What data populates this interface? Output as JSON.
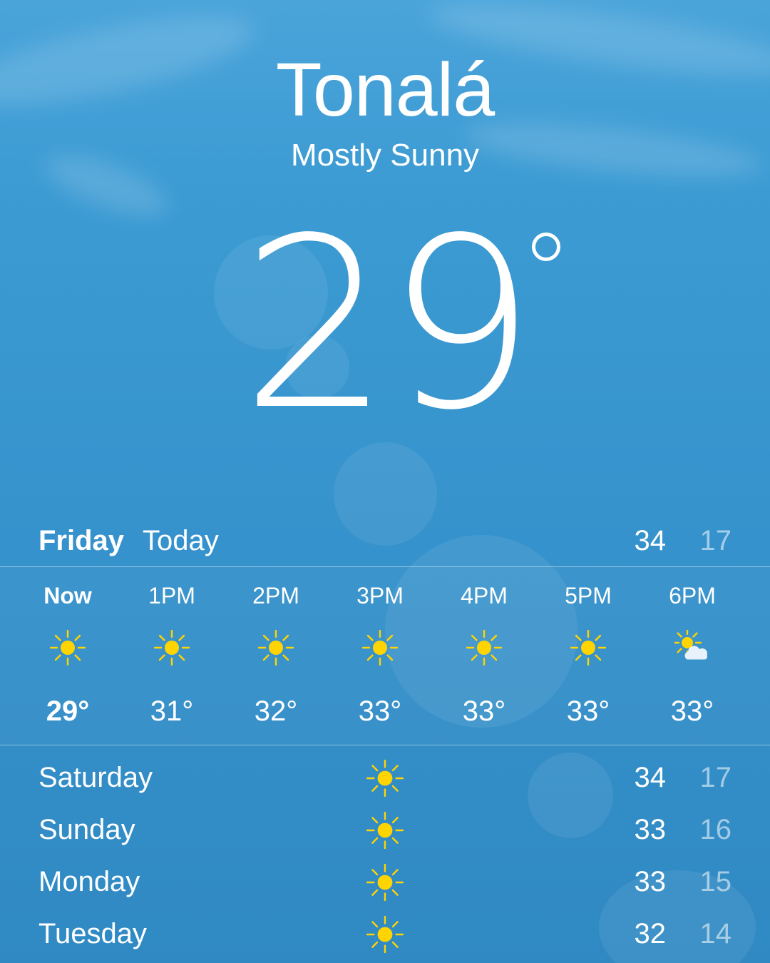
{
  "location": "Tonalá",
  "condition": "Mostly Sunny",
  "current_temp": "29",
  "today": {
    "day": "Friday",
    "label": "Today",
    "high": "34",
    "low": "17"
  },
  "hourly": [
    {
      "time": "Now",
      "icon": "sun-icon",
      "temp": "29°"
    },
    {
      "time": "1PM",
      "icon": "sun-icon",
      "temp": "31°"
    },
    {
      "time": "2PM",
      "icon": "sun-icon",
      "temp": "32°"
    },
    {
      "time": "3PM",
      "icon": "sun-icon",
      "temp": "33°"
    },
    {
      "time": "4PM",
      "icon": "sun-icon",
      "temp": "33°"
    },
    {
      "time": "5PM",
      "icon": "sun-icon",
      "temp": "33°"
    },
    {
      "time": "6PM",
      "icon": "partly-cloudy-icon",
      "temp": "33°"
    }
  ],
  "daily": [
    {
      "day": "Saturday",
      "icon": "sun-icon",
      "high": "34",
      "low": "17"
    },
    {
      "day": "Sunday",
      "icon": "sun-icon",
      "high": "33",
      "low": "16"
    },
    {
      "day": "Monday",
      "icon": "sun-icon",
      "high": "33",
      "low": "15"
    },
    {
      "day": "Tuesday",
      "icon": "sun-icon",
      "high": "32",
      "low": "14"
    }
  ],
  "colors": {
    "background_top": "#4aa4da",
    "background_bottom": "#3089c3",
    "sun": "#ffd400",
    "cloud": "#e8f2fa",
    "low_temp_text": "rgba(255,255,255,0.55)"
  }
}
